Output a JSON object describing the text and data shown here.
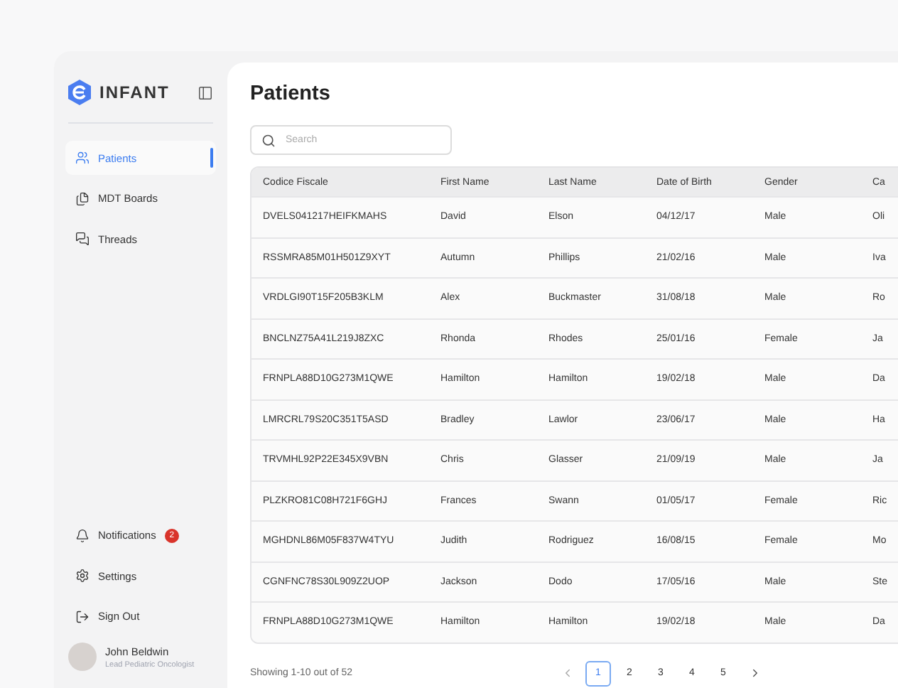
{
  "brand": {
    "name": "INFANT"
  },
  "sidebar": {
    "items": [
      {
        "label": "Patients",
        "selected": true
      },
      {
        "label": "MDT Boards",
        "selected": false
      },
      {
        "label": "Threads",
        "selected": false
      }
    ],
    "bottom_items": [
      {
        "label": "Notifications",
        "badge": "2"
      },
      {
        "label": "Settings"
      },
      {
        "label": "Sign Out"
      }
    ],
    "user": {
      "name": "John Beldwin",
      "role": "Lead Pediatric Oncologist"
    }
  },
  "page": {
    "title": "Patients"
  },
  "search": {
    "placeholder": "Search"
  },
  "table": {
    "columns": [
      "Codice Fiscale",
      "First Name",
      "Last Name",
      "Date of Birth",
      "Gender",
      "Ca"
    ],
    "rows": [
      [
        "DVELS041217HEIFKMAHS",
        "David",
        "Elson",
        "04/12/17",
        "Male",
        "Oli"
      ],
      [
        "RSSMRA85M01H501Z9XYT",
        "Autumn",
        "Phillips",
        "21/02/16",
        "Male",
        "Iva"
      ],
      [
        "VRDLGI90T15F205B3KLM",
        "Alex",
        "Buckmaster",
        "31/08/18",
        "Male",
        "Ro"
      ],
      [
        "BNCLNZ75A41L219J8ZXC",
        "Rhonda",
        "Rhodes",
        "25/01/16",
        "Female",
        "Ja"
      ],
      [
        "FRNPLA88D10G273M1QWE",
        "Hamilton",
        "Hamilton",
        "19/02/18",
        "Male",
        "Da"
      ],
      [
        "LMRCRL79S20C351T5ASD",
        "Bradley",
        "Lawlor",
        "23/06/17",
        "Male",
        "Ha"
      ],
      [
        "TRVMHL92P22E345X9VBN",
        "Chris",
        "Glasser",
        "21/09/19",
        "Male",
        "Ja"
      ],
      [
        "PLZKRO81C08H721F6GHJ",
        "Frances",
        "Swann",
        "01/05/17",
        "Female",
        "Ric"
      ],
      [
        "MGHDNL86M05F837W4TYU",
        "Judith",
        "Rodriguez",
        "16/08/15",
        "Female",
        "Mo"
      ],
      [
        "CGNFNC78S30L909Z2UOP",
        "Jackson",
        "Dodo",
        "17/05/16",
        "Male",
        "Ste"
      ],
      [
        "FRNPLA88D10G273M1QWE",
        "Hamilton",
        "Hamilton",
        "19/02/18",
        "Male",
        "Da"
      ]
    ]
  },
  "footer": {
    "showing": "Showing 1-10 out of 52",
    "pages": [
      {
        "label": "1",
        "selected": true
      },
      {
        "label": "2",
        "selected": false
      },
      {
        "label": "3",
        "selected": false
      },
      {
        "label": "4",
        "selected": false
      },
      {
        "label": "5",
        "selected": false
      }
    ]
  }
}
